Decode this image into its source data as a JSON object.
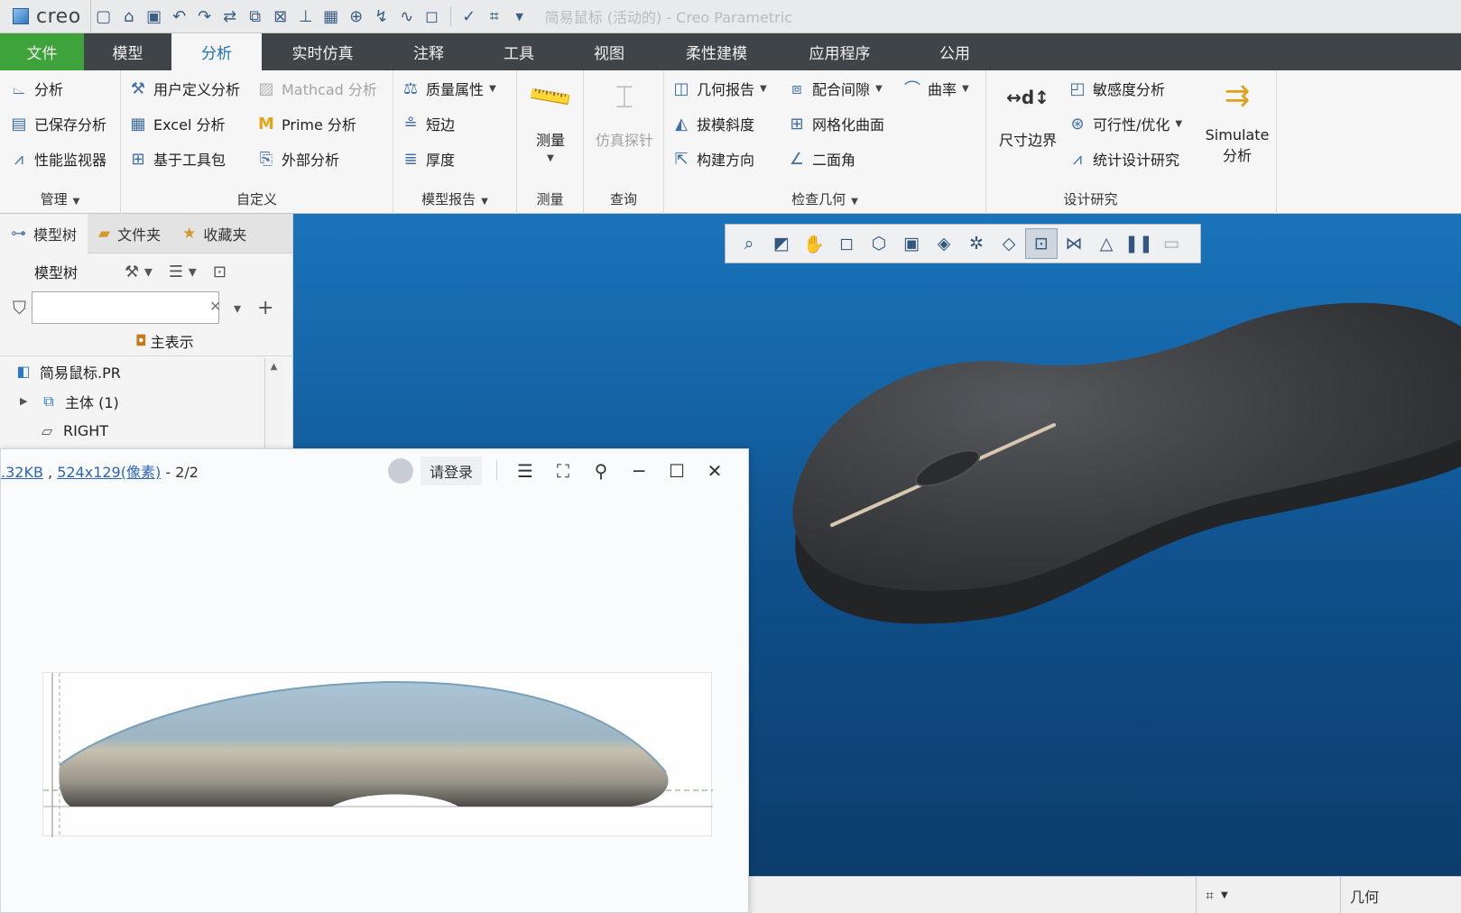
{
  "window": {
    "app_name": "creo",
    "title": "简易鼠标 (活动的) - Creo Parametric"
  },
  "qat_icons": [
    "new-file-icon",
    "open-folder-icon",
    "save-icon",
    "undo-icon",
    "redo-icon",
    "regenerate-icon",
    "window-icon",
    "close-window-icon",
    "coord-sys-icon",
    "plane-icon",
    "axis-icon",
    "csys-icon",
    "curve-icon",
    "sketch-icon",
    "ok-check-icon",
    "select-icon"
  ],
  "tabs": [
    {
      "label": "文件"
    },
    {
      "label": "模型"
    },
    {
      "label": "分析"
    },
    {
      "label": "实时仿真"
    },
    {
      "label": "注释"
    },
    {
      "label": "工具"
    },
    {
      "label": "视图"
    },
    {
      "label": "柔性建模"
    },
    {
      "label": "应用程序"
    },
    {
      "label": "公用"
    }
  ],
  "ribbon": {
    "manage": {
      "label": "管理",
      "items": [
        "分析",
        "已保存分析",
        "性能监视器"
      ]
    },
    "custom": {
      "label": "自定义",
      "items": [
        "用户定义分析",
        "Mathcad 分析",
        "Excel 分析",
        "Prime 分析",
        "基于工具包",
        "外部分析"
      ]
    },
    "model_report": {
      "label": "模型报告",
      "items": [
        "质量属性",
        "短边",
        "厚度"
      ]
    },
    "measure": {
      "label": "测量",
      "button": "测量"
    },
    "query": {
      "label": "查询",
      "button": "仿真探针"
    },
    "inspect": {
      "label": "检查几何",
      "items": [
        "几何报告",
        "配合间隙",
        "曲率",
        "拔模斜度",
        "网格化曲面",
        "构建方向",
        "二面角"
      ]
    },
    "design": {
      "label": "设计研究",
      "dim_boundary": "尺寸边界",
      "items": [
        "敏感度分析",
        "可行性/优化",
        "统计设计研究"
      ],
      "simulate_line1": "Simulate",
      "simulate_line2": "分析"
    }
  },
  "left_panel": {
    "tabs": [
      "模型树",
      "文件夹",
      "收藏夹"
    ],
    "tree_header": "模型树",
    "filter_placeholder": "",
    "representation": "主表示",
    "tree_items": [
      "简易鼠标.PR",
      "主体 (1)",
      "RIGHT"
    ]
  },
  "graphics_toolbar_icons": [
    "zoom-icon",
    "refit-icon",
    "pan-icon",
    "view-icon",
    "saved-views-icon",
    "display-style-icon",
    "appearance-icon",
    "datum-display-icon",
    "annotation-icon",
    "spin-center-icon",
    "sectional-icon",
    "repaint-icon",
    "pause-icon",
    "stop-icon"
  ],
  "viewer": {
    "file_size": ".32KB",
    "dimensions": "524x129(像素)",
    "page_counter": "- 2/2",
    "login": "请登录"
  },
  "status_bar": {
    "filter": "几何"
  },
  "colors": {
    "file_tab": "#3ea33a",
    "tab_bar": "#3e4448",
    "active_tab_text": "#1d6fb9",
    "viewport_top": "#1a73b9",
    "viewport_bottom": "#0c3d6c",
    "mouse_body": "#3a3c3f"
  }
}
